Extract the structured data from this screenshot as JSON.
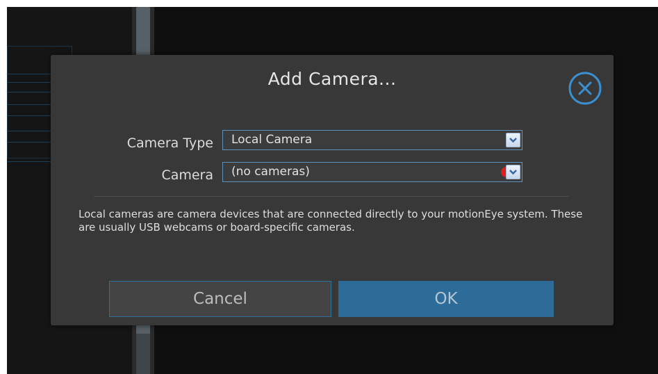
{
  "dialog": {
    "title": "Add Camera...",
    "fields": {
      "camera_type_label": "Camera Type",
      "camera_type_value": "Local Camera",
      "camera_label": "Camera",
      "camera_value": "(no cameras)"
    },
    "description": "Local cameras are camera devices that are connected directly to your motionEye system. These are usually USB webcams or board-specific cameras.",
    "buttons": {
      "cancel_label": "Cancel",
      "ok_label": "OK"
    }
  },
  "icons": {
    "close": "close-circle-icon",
    "dropdown": "chevron-down-icon"
  },
  "colors": {
    "accent": "#2d6b98",
    "dialog_bg": "#383838",
    "page_bg": "#121212",
    "error": "#d82121"
  }
}
